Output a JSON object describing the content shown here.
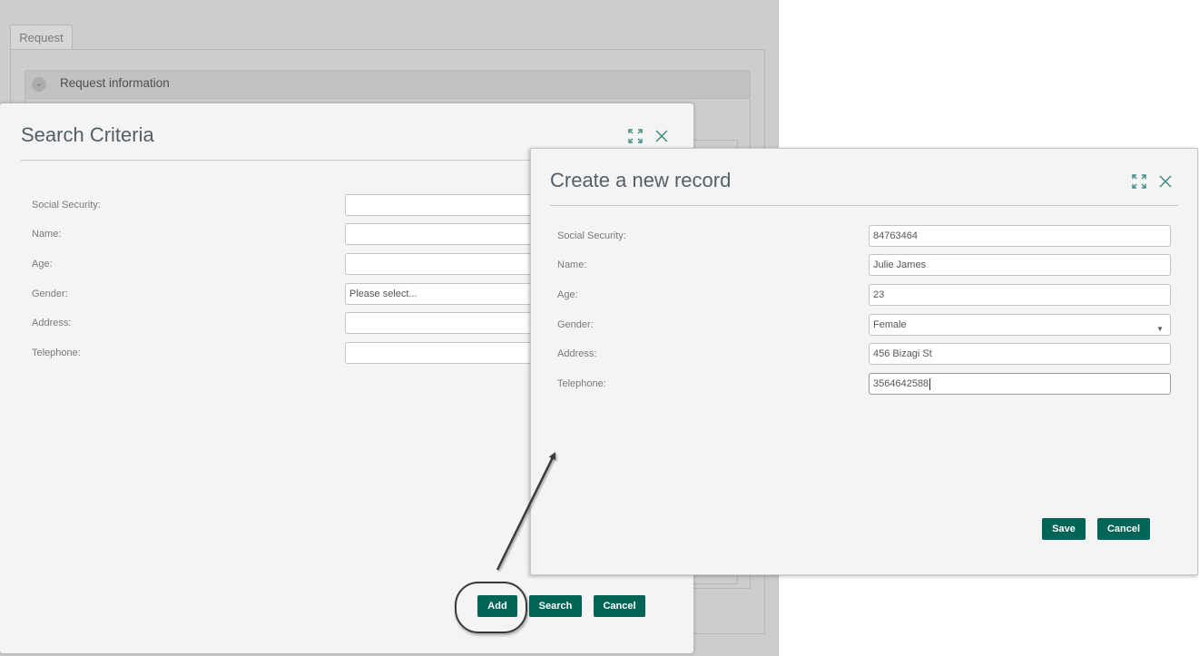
{
  "background": {
    "tab_label": "Request",
    "section_title": "Request information"
  },
  "search_dialog": {
    "title": "Search Criteria",
    "fields": [
      {
        "label": "Social Security:",
        "value": ""
      },
      {
        "label": "Name:",
        "value": ""
      },
      {
        "label": "Age:",
        "value": ""
      },
      {
        "label": "Gender:",
        "value": "Please select..."
      },
      {
        "label": "Address:",
        "value": ""
      },
      {
        "label": "Telephone:",
        "value": ""
      }
    ],
    "buttons": {
      "add": "Add",
      "search": "Search",
      "cancel": "Cancel"
    }
  },
  "create_dialog": {
    "title": "Create a new record",
    "fields": [
      {
        "label": "Social Security:",
        "value": "84763464"
      },
      {
        "label": "Name:",
        "value": "Julie James"
      },
      {
        "label": "Age:",
        "value": "23"
      },
      {
        "label": "Gender:",
        "value": "Female"
      },
      {
        "label": "Address:",
        "value": "456 Bizagi St"
      },
      {
        "label": "Telephone:",
        "value": "3564642588"
      }
    ],
    "buttons": {
      "save": "Save",
      "cancel": "Cancel"
    }
  },
  "icons": {
    "maximize": "maximize-icon",
    "close": "close-icon",
    "chevron": "chevron-down-icon"
  },
  "colors": {
    "primary_button": "#006456",
    "icon": "#3d8a7f",
    "dim_background": "#cdcdcd"
  }
}
